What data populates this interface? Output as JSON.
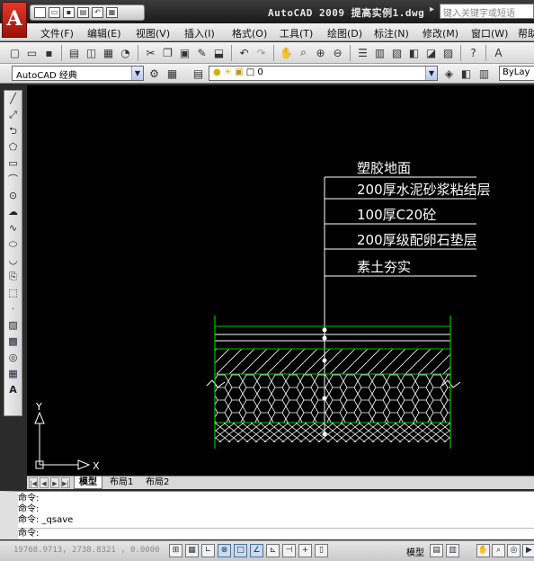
{
  "window": {
    "app_letter": "A",
    "title": "AutoCAD 2009  提高实例1.dwg",
    "title_arrow": "▸",
    "search_placeholder": "键入关键字或短语"
  },
  "menu": [
    "文件(F)",
    "编辑(E)",
    "视图(V)",
    "插入(I)",
    "格式(O)",
    "工具(T)",
    "绘图(D)",
    "标注(N)",
    "修改(M)",
    "窗口(W)",
    "帮助"
  ],
  "toolbar2": {
    "workspace": "AutoCAD 经典",
    "layer": "0",
    "linetype": "ByLay"
  },
  "drawing": {
    "labels": [
      "塑胶地面",
      "200厚水泥砂浆粘结层",
      "100厚C20砼",
      "200厚级配卵石垫层",
      "素土夯实"
    ],
    "ucs_y": "Y",
    "ucs_x": "X"
  },
  "tabs": {
    "model": "模型",
    "layout1": "布局1",
    "layout2": "布局2"
  },
  "command_lines": [
    "命令:",
    "命令:",
    "命令: _qsave",
    "命令:"
  ],
  "status": {
    "coords": "19768.9713,  2738.8321 ,  0.0000",
    "model_label": "模型"
  },
  "colors": {
    "canvas": "#000000",
    "layer_green": "#00c800",
    "white_lines": "#ffffff"
  }
}
